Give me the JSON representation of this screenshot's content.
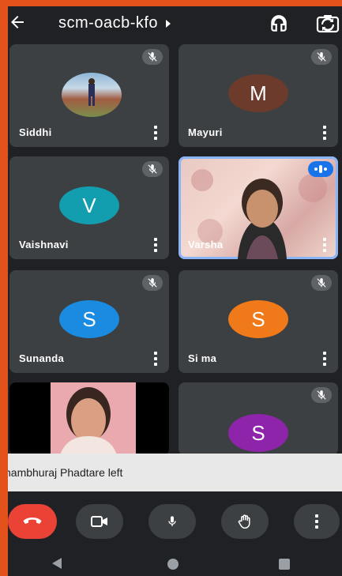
{
  "meeting": {
    "code": "scm-oacb-kfo"
  },
  "participants": [
    {
      "name": "Siddhi",
      "avatar_letter": "",
      "avatar_color": "",
      "muted": true
    },
    {
      "name": "Mayuri",
      "avatar_letter": "M",
      "avatar_color": "#6d3b2c",
      "muted": true
    },
    {
      "name": "Vaishnavi",
      "avatar_letter": "V",
      "avatar_color": "#129eaf",
      "muted": true
    },
    {
      "name": "Varsha",
      "avatar_letter": "",
      "avatar_color": "",
      "muted": false,
      "speaking": true
    },
    {
      "name": "Sunanda",
      "avatar_letter": "S",
      "avatar_color": "#1a8be0",
      "muted": true
    },
    {
      "name": "Si ma",
      "avatar_letter": "S",
      "avatar_color": "#f07a1a",
      "muted": true
    },
    {
      "name": "",
      "avatar_letter": "",
      "avatar_color": "",
      "muted": false
    },
    {
      "name": "",
      "avatar_letter": "S",
      "avatar_color": "#8e24aa",
      "muted": true
    }
  ],
  "notification": {
    "text": "hambhuraj Phadtare left"
  },
  "colors": {
    "end_call": "#ea4335",
    "control_bg": "#3c4043",
    "tile_bg": "#3c4043",
    "screen_bg": "#202124",
    "frame": "#e2521a"
  },
  "icons": {
    "back": "arrow-left-icon",
    "caret": "caret-right-icon",
    "audio": "headset-icon",
    "camera_switch": "flip-camera-icon",
    "end_call": "end-call-icon",
    "camera": "videocam-icon",
    "mic": "mic-icon",
    "raise_hand": "hand-icon",
    "more": "more-vertical-icon"
  }
}
